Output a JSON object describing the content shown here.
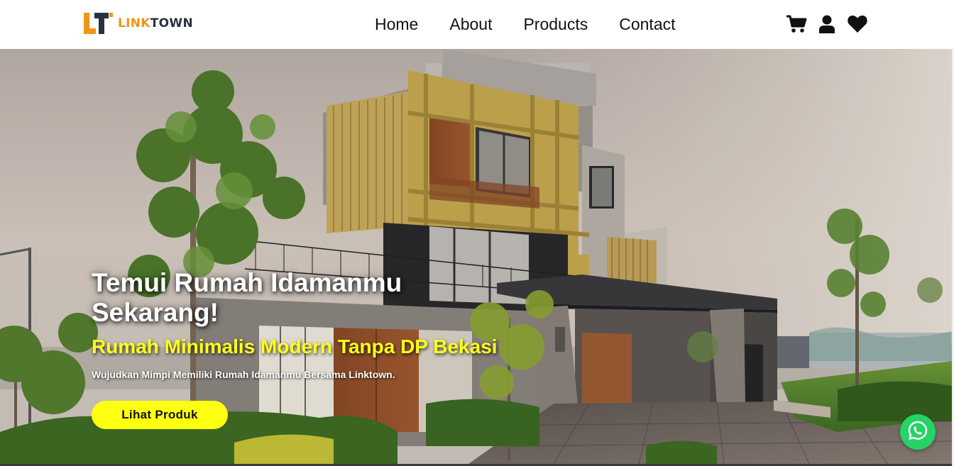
{
  "brand": {
    "logo_text_accent": "LINK",
    "logo_text_rest": "TOWN",
    "accent_color": "#f39318",
    "dark_color": "#2b3140"
  },
  "nav": {
    "links": [
      {
        "label": "Home"
      },
      {
        "label": "About"
      },
      {
        "label": "Products"
      },
      {
        "label": "Contact"
      }
    ],
    "icons": [
      "cart-icon",
      "user-icon",
      "heart-icon"
    ]
  },
  "hero": {
    "title": "Temui Rumah Idamanmu Sekarang!",
    "subtitle": "Rumah Minimalis Modern Tanpa DP Bekasi",
    "description": "Wujudkan Mimpi Memiliki Rumah Idamanmu Bersama Linktown.",
    "cta_label": "Lihat Produk",
    "subtitle_color": "#ffff1a",
    "cta_color": "#ffff12"
  },
  "floating": {
    "whatsapp_icon": "whatsapp-icon",
    "whatsapp_color": "#25d366"
  }
}
